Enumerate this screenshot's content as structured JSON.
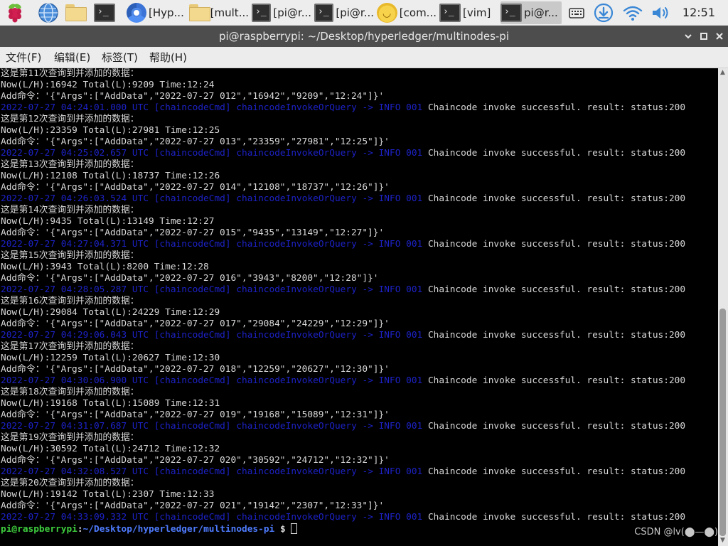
{
  "taskbar": {
    "buttons": [
      {
        "label": "[Hyp..."
      },
      {
        "label": "[mult..."
      },
      {
        "label": "[pi@r..."
      },
      {
        "label": "[pi@r..."
      },
      {
        "label": "[com..."
      },
      {
        "label": "[vim]"
      },
      {
        "label": "pi@r..."
      }
    ],
    "clock": "12:51"
  },
  "window": {
    "title": "pi@raspberrypi: ~/Desktop/hyperledger/multinodes-pi"
  },
  "menu": [
    "文件(F)",
    "编辑(E)",
    "标签(T)",
    "帮助(H)"
  ],
  "terminal": {
    "lines": [
      {
        "kind": "text",
        "text": "这是第11次查询到并添加的数据："
      },
      {
        "kind": "text",
        "text": "Now(L/H):16942 Total(L):9209 Time:12:24"
      },
      {
        "kind": "text",
        "text": "Add命令：'{\"Args\":[\"AddData\",\"2022-07-27 012\",\"16942\",\"9209\",\"12:24\"]}'"
      },
      {
        "kind": "log",
        "log": "2022-07-27 04:24:01.000 UTC [chaincodeCmd] chaincodeInvokeOrQuery -> INFO 001",
        "msg": " Chaincode invoke successful. result: status:200"
      },
      {
        "kind": "text",
        "text": "这是第12次查询到并添加的数据："
      },
      {
        "kind": "text",
        "text": "Now(L/H):23359 Total(L):27981 Time:12:25"
      },
      {
        "kind": "text",
        "text": "Add命令：'{\"Args\":[\"AddData\",\"2022-07-27 013\",\"23359\",\"27981\",\"12:25\"]}'"
      },
      {
        "kind": "log",
        "log": "2022-07-27 04:25:02.657 UTC [chaincodeCmd] chaincodeInvokeOrQuery -> INFO 001",
        "msg": " Chaincode invoke successful. result: status:200"
      },
      {
        "kind": "text",
        "text": "这是第13次查询到并添加的数据："
      },
      {
        "kind": "text",
        "text": "Now(L/H):12108 Total(L):18737 Time:12:26"
      },
      {
        "kind": "text",
        "text": "Add命令：'{\"Args\":[\"AddData\",\"2022-07-27 014\",\"12108\",\"18737\",\"12:26\"]}'"
      },
      {
        "kind": "log",
        "log": "2022-07-27 04:26:03.524 UTC [chaincodeCmd] chaincodeInvokeOrQuery -> INFO 001",
        "msg": " Chaincode invoke successful. result: status:200"
      },
      {
        "kind": "text",
        "text": "这是第14次查询到并添加的数据："
      },
      {
        "kind": "text",
        "text": "Now(L/H):9435 Total(L):13149 Time:12:27"
      },
      {
        "kind": "text",
        "text": "Add命令：'{\"Args\":[\"AddData\",\"2022-07-27 015\",\"9435\",\"13149\",\"12:27\"]}'"
      },
      {
        "kind": "log",
        "log": "2022-07-27 04:27:04.371 UTC [chaincodeCmd] chaincodeInvokeOrQuery -> INFO 001",
        "msg": " Chaincode invoke successful. result: status:200"
      },
      {
        "kind": "text",
        "text": "这是第15次查询到并添加的数据："
      },
      {
        "kind": "text",
        "text": "Now(L/H):3943 Total(L):8200 Time:12:28"
      },
      {
        "kind": "text",
        "text": "Add命令：'{\"Args\":[\"AddData\",\"2022-07-27 016\",\"3943\",\"8200\",\"12:28\"]}'"
      },
      {
        "kind": "log",
        "log": "2022-07-27 04:28:05.287 UTC [chaincodeCmd] chaincodeInvokeOrQuery -> INFO 001",
        "msg": " Chaincode invoke successful. result: status:200"
      },
      {
        "kind": "text",
        "text": "这是第16次查询到并添加的数据："
      },
      {
        "kind": "text",
        "text": "Now(L/H):29084 Total(L):24229 Time:12:29"
      },
      {
        "kind": "text",
        "text": "Add命令：'{\"Args\":[\"AddData\",\"2022-07-27 017\",\"29084\",\"24229\",\"12:29\"]}'"
      },
      {
        "kind": "log",
        "log": "2022-07-27 04:29:06.043 UTC [chaincodeCmd] chaincodeInvokeOrQuery -> INFO 001",
        "msg": " Chaincode invoke successful. result: status:200"
      },
      {
        "kind": "text",
        "text": "这是第17次查询到并添加的数据："
      },
      {
        "kind": "text",
        "text": "Now(L/H):12259 Total(L):20627 Time:12:30"
      },
      {
        "kind": "text",
        "text": "Add命令：'{\"Args\":[\"AddData\",\"2022-07-27 018\",\"12259\",\"20627\",\"12:30\"]}'"
      },
      {
        "kind": "log",
        "log": "2022-07-27 04:30:06.900 UTC [chaincodeCmd] chaincodeInvokeOrQuery -> INFO 001",
        "msg": " Chaincode invoke successful. result: status:200"
      },
      {
        "kind": "text",
        "text": "这是第18次查询到并添加的数据："
      },
      {
        "kind": "text",
        "text": "Now(L/H):19168 Total(L):15089 Time:12:31"
      },
      {
        "kind": "text",
        "text": "Add命令：'{\"Args\":[\"AddData\",\"2022-07-27 019\",\"19168\",\"15089\",\"12:31\"]}'"
      },
      {
        "kind": "log",
        "log": "2022-07-27 04:31:07.687 UTC [chaincodeCmd] chaincodeInvokeOrQuery -> INFO 001",
        "msg": " Chaincode invoke successful. result: status:200"
      },
      {
        "kind": "text",
        "text": "这是第19次查询到并添加的数据："
      },
      {
        "kind": "text",
        "text": "Now(L/H):30592 Total(L):24712 Time:12:32"
      },
      {
        "kind": "text",
        "text": "Add命令：'{\"Args\":[\"AddData\",\"2022-07-27 020\",\"30592\",\"24712\",\"12:32\"]}'"
      },
      {
        "kind": "log",
        "log": "2022-07-27 04:32:08.527 UTC [chaincodeCmd] chaincodeInvokeOrQuery -> INFO 001",
        "msg": " Chaincode invoke successful. result: status:200"
      },
      {
        "kind": "text",
        "text": "这是第20次查询到并添加的数据："
      },
      {
        "kind": "text",
        "text": "Now(L/H):19142 Total(L):2307 Time:12:33"
      },
      {
        "kind": "text",
        "text": "Add命令：'{\"Args\":[\"AddData\",\"2022-07-27 021\",\"19142\",\"2307\",\"12:33\"]}'"
      },
      {
        "kind": "log",
        "log": "2022-07-27 04:33:09.332 UTC [chaincodeCmd] chaincodeInvokeOrQuery -> INFO 001",
        "msg": " Chaincode invoke successful. result: status:200"
      }
    ],
    "prompt": {
      "user_host": "pi@raspberrypi",
      "sep": ":",
      "path": "~/Desktop/hyperledger/multinodes-pi",
      "symbol": " $ "
    }
  },
  "watermark": "CSDN @lv(⬤—⬤)",
  "colors": {
    "log_text": "#1d22c6",
    "prompt_user": "#3ecf3e",
    "prompt_path": "#4f7cff",
    "terminal_bg": "#000000",
    "titlebar_bg": "#4d4d4d"
  }
}
